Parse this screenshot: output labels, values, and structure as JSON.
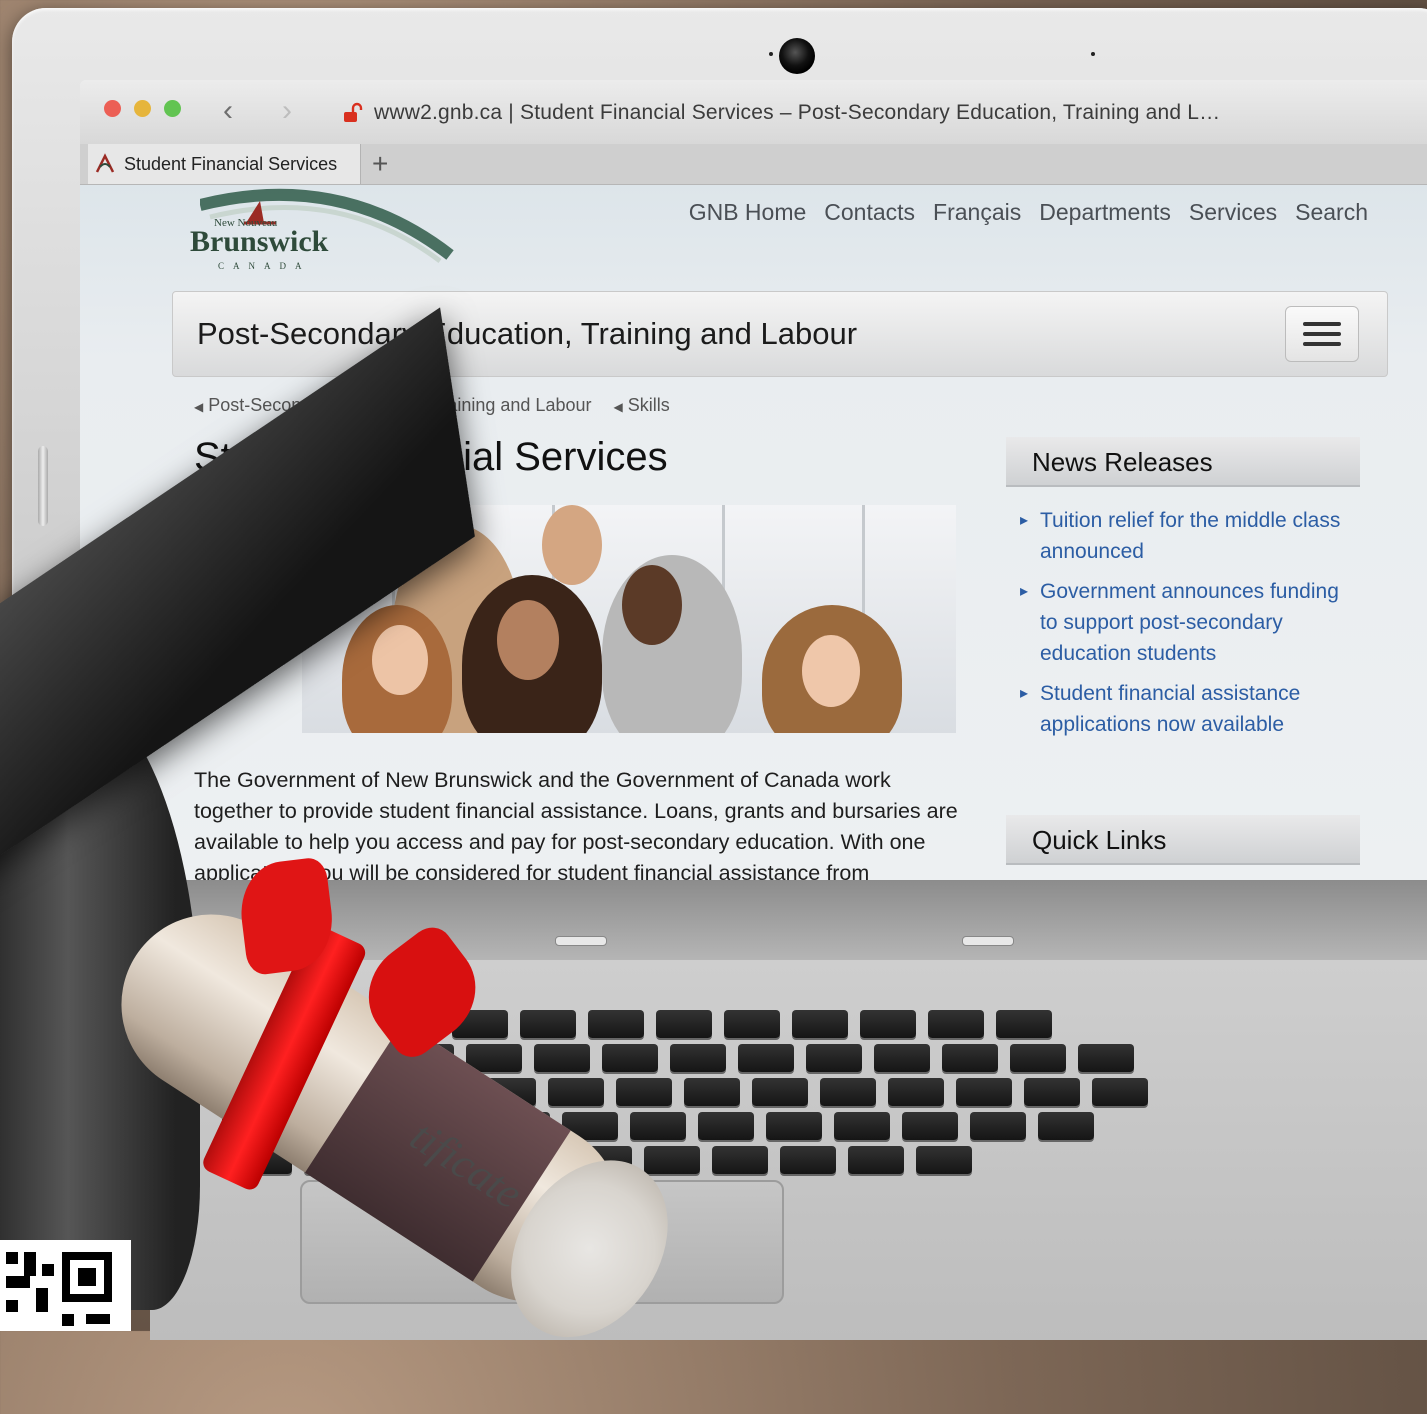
{
  "browser": {
    "url": "www2.gnb.ca | Student Financial Services – Post-Secondary Education, Training and L…",
    "tab_label": "Student Financial Services",
    "new_tab": "+"
  },
  "site": {
    "logo": {
      "small": "New  Nouveau",
      "main": "Brunswick",
      "country": "CANADA"
    },
    "nav": [
      "GNB Home",
      "Contacts",
      "Français",
      "Departments",
      "Services",
      "Search"
    ],
    "department": "Post-Secondary Education, Training and Labour",
    "breadcrumbs": [
      "Post-Secondary Education, Training and Labour",
      "Skills"
    ],
    "page_title": "Student Financial Services",
    "body_text": "The Government of New Brunswick and the Government of Canada work together to provide student financial assistance. Loans, grants and bursaries are available to help you access and pay for post-secondary education. With one application, you will be considered for student financial assistance from",
    "news_heading": "News Releases",
    "news": [
      "Tuition relief for the middle class announced",
      "Government announces funding to support post-secondary education students",
      "Student financial assistance applications now available"
    ],
    "quick_links_heading": "Quick Links"
  },
  "scene": {
    "certificate_text": "tificate"
  },
  "colors": {
    "link": "#2c5da4",
    "close": "#ec5f55",
    "minimize": "#e6b53c",
    "zoom": "#62c452"
  }
}
